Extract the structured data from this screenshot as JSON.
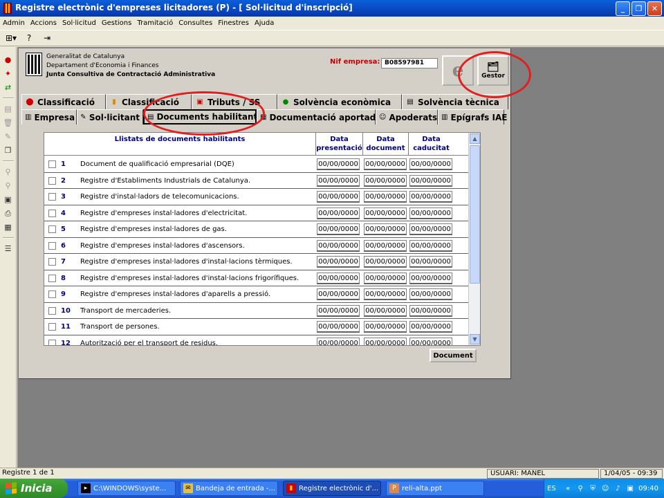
{
  "window": {
    "title": "Registre electrònic d'empreses licitadores (P) - [ Sol·licitud d'inscripció]"
  },
  "menu": [
    "Admin",
    "Accions",
    "Sol·licitud",
    "Gestions",
    "Tramitació",
    "Consultes",
    "Finestres",
    "Ajuda"
  ],
  "header": {
    "org_line1": "Generalitat de Catalunya",
    "org_line2": "Departament d'Economia i Finances",
    "org_line3": "Junta Consultiva de Contractació Administrativa",
    "nif_label": "Nif empresa:",
    "nif_value": "B08597981",
    "gestor_label": "Gestor"
  },
  "tabs_row1": [
    {
      "label": "Classificació",
      "icon": "red-flag-icon"
    },
    {
      "label": "Classificació",
      "icon": "catalan-flag-icon"
    },
    {
      "label": "Tributs / SS",
      "icon": "tax-icon"
    },
    {
      "label": "Solvència econòmica",
      "icon": "money-icon"
    },
    {
      "label": "Solvència tècnica",
      "icon": "technical-icon"
    }
  ],
  "tabs_row2": [
    {
      "label": "Empresa",
      "icon": "building-icon"
    },
    {
      "label": "Sol·licitant",
      "icon": "form-icon"
    },
    {
      "label": "Documents habilitants",
      "icon": "documents-icon",
      "active": true
    },
    {
      "label": "Documentació aportada",
      "icon": "docs-provided-icon"
    },
    {
      "label": "Apoderats",
      "icon": "people-icon"
    },
    {
      "label": "Epígrafs IAE",
      "icon": "iae-icon"
    }
  ],
  "grid": {
    "header": "Llistats de documents habilitants",
    "col_presentacio": "Data presentació",
    "col_document": "Data document",
    "col_caducitat": "Data caducitat",
    "rows": [
      {
        "num": "1",
        "label": "Document de qualificació empresarial (DQE)",
        "presentacio": "00/00/0000",
        "document": "00/00/0000",
        "caducitat": "00/00/0000"
      },
      {
        "num": "2",
        "label": "Registre d'Establiments Industrials de Catalunya.",
        "presentacio": "00/00/0000",
        "document": "00/00/0000",
        "caducitat": "00/00/0000"
      },
      {
        "num": "3",
        "label": "Registre d'instal·ladors de telecomunicacions.",
        "presentacio": "00/00/0000",
        "document": "00/00/0000",
        "caducitat": "00/00/0000"
      },
      {
        "num": "4",
        "label": "Registre d'empreses instal·ladores d'electricitat.",
        "presentacio": "00/00/0000",
        "document": "00/00/0000",
        "caducitat": "00/00/0000"
      },
      {
        "num": "5",
        "label": "Registre d'empreses instal·ladores de gas.",
        "presentacio": "00/00/0000",
        "document": "00/00/0000",
        "caducitat": "00/00/0000"
      },
      {
        "num": "6",
        "label": "Registre d'empreses instal·ladores d'ascensors.",
        "presentacio": "00/00/0000",
        "document": "00/00/0000",
        "caducitat": "00/00/0000"
      },
      {
        "num": "7",
        "label": "Registre d'empreses instal·ladores d'instal·lacions tèrmiques.",
        "presentacio": "00/00/0000",
        "document": "00/00/0000",
        "caducitat": "00/00/0000"
      },
      {
        "num": "8",
        "label": "Registre d'empreses instal·ladores d'instal·lacions frigorífiques.",
        "presentacio": "00/00/0000",
        "document": "00/00/0000",
        "caducitat": "00/00/0000"
      },
      {
        "num": "9",
        "label": "Registre d'empreses instal·ladores d'aparells a pressió.",
        "presentacio": "00/00/0000",
        "document": "00/00/0000",
        "caducitat": "00/00/0000"
      },
      {
        "num": "10",
        "label": "Transport de mercaderies.",
        "presentacio": "00/00/0000",
        "document": "00/00/0000",
        "caducitat": "00/00/0000"
      },
      {
        "num": "11",
        "label": "Transport de persones.",
        "presentacio": "00/00/0000",
        "document": "00/00/0000",
        "caducitat": "00/00/0000"
      },
      {
        "num": "12",
        "label": "Autorització per el transport de residus.",
        "presentacio": "00/00/0000",
        "document": "00/00/0000",
        "caducitat": "00/00/0000"
      }
    ]
  },
  "document_button": "Document",
  "status": {
    "record": "Registre 1 de 1",
    "user": "USUARI: MANEL",
    "datetime": "1/04/05 - 09:39"
  },
  "taskbar": {
    "start": "Inicia",
    "tasks": [
      {
        "label": "C:\\WINDOWS\\syste...",
        "icon": "cmd-icon"
      },
      {
        "label": "Bandeja de entrada -...",
        "icon": "outlook-icon"
      },
      {
        "label": "Registre electrònic d'...",
        "icon": "app-icon",
        "active": true
      },
      {
        "label": "reli-alta.ppt",
        "icon": "powerpoint-icon"
      }
    ],
    "lang": "ES",
    "clock": "09:40"
  },
  "colors": {
    "accent": "#0a47c0",
    "annotation": "#e02020",
    "nif_label": "#c00000"
  }
}
